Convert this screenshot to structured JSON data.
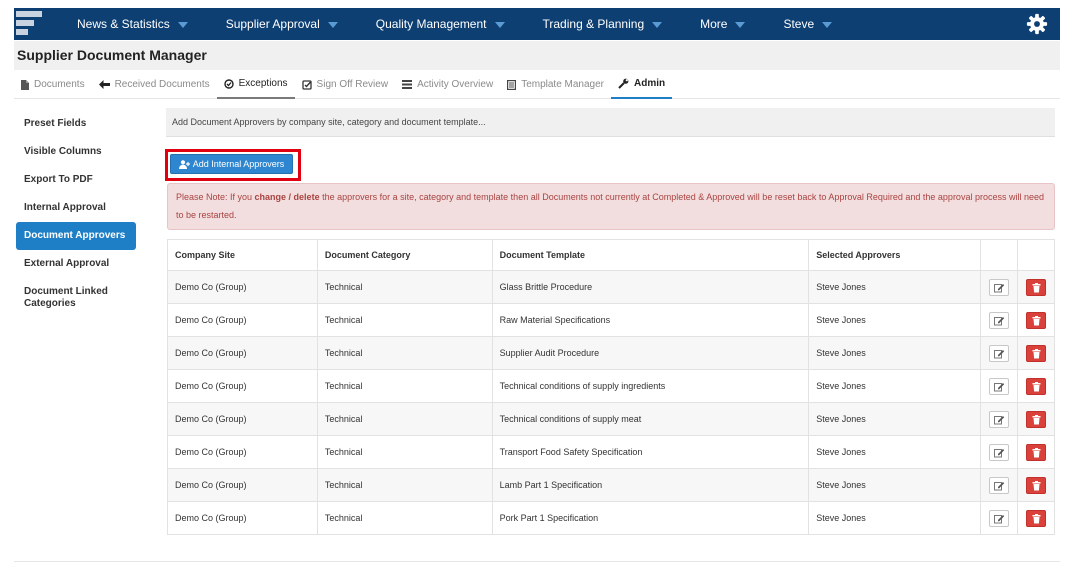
{
  "nav": {
    "items": [
      {
        "label": "News & Statistics"
      },
      {
        "label": "Supplier Approval"
      },
      {
        "label": "Quality Management"
      },
      {
        "label": "Trading & Planning"
      },
      {
        "label": "More"
      },
      {
        "label": "Steve"
      }
    ],
    "icons": {
      "logo": "app-logo",
      "settings": "gear-icon",
      "dropdown": "caret-down-icon"
    }
  },
  "page_title": "Supplier Document Manager",
  "tabs": [
    {
      "label": "Documents",
      "icon": "file-icon"
    },
    {
      "label": "Received Documents",
      "icon": "arrow-left-icon"
    },
    {
      "label": "Exceptions",
      "icon": "check-circle-icon"
    },
    {
      "label": "Sign Off Review",
      "icon": "check-square-icon"
    },
    {
      "label": "Activity Overview",
      "icon": "list-icon"
    },
    {
      "label": "Template Manager",
      "icon": "document-icon"
    },
    {
      "label": "Admin",
      "icon": "wrench-icon"
    }
  ],
  "sidebar": {
    "items": [
      {
        "label": "Preset Fields"
      },
      {
        "label": "Visible Columns"
      },
      {
        "label": "Export To PDF"
      },
      {
        "label": "Internal Approval"
      },
      {
        "label": "Document Approvers"
      },
      {
        "label": "External Approval"
      },
      {
        "label": "Document Linked Categories"
      }
    ],
    "active_index": 4
  },
  "info_text": "Add Document Approvers by company site, category and document template...",
  "add_button": {
    "label": "Add Internal Approvers",
    "icon": "add-user-icon"
  },
  "alert": {
    "prefix": "Please Note: If you ",
    "bold": "change / delete",
    "suffix": " the approvers for a site, category and template then all Documents not currently at Completed & Approved will be reset back to Approval Required and the approval process will need to be restarted."
  },
  "table": {
    "headers": [
      "Company Site",
      "Document Category",
      "Document Template",
      "Selected Approvers"
    ],
    "rows": [
      {
        "site": "Demo Co (Group)",
        "category": "Technical",
        "template": "Glass Brittle Procedure",
        "approvers": "Steve Jones"
      },
      {
        "site": "Demo Co (Group)",
        "category": "Technical",
        "template": "Raw Material Specifications",
        "approvers": "Steve Jones"
      },
      {
        "site": "Demo Co (Group)",
        "category": "Technical",
        "template": "Supplier Audit Procedure",
        "approvers": "Steve Jones"
      },
      {
        "site": "Demo Co (Group)",
        "category": "Technical",
        "template": "Technical conditions of supply ingredients",
        "approvers": "Steve Jones"
      },
      {
        "site": "Demo Co (Group)",
        "category": "Technical",
        "template": "Technical conditions of supply meat",
        "approvers": "Steve Jones"
      },
      {
        "site": "Demo Co (Group)",
        "category": "Technical",
        "template": "Transport Food Safety Specification",
        "approvers": "Steve Jones"
      },
      {
        "site": "Demo Co (Group)",
        "category": "Technical",
        "template": "Lamb Part 1 Specification",
        "approvers": "Steve Jones"
      },
      {
        "site": "Demo Co (Group)",
        "category": "Technical",
        "template": "Pork Part 1 Specification",
        "approvers": "Steve Jones"
      }
    ],
    "row_icons": {
      "edit": "edit-icon",
      "delete": "trash-icon"
    }
  },
  "colors": {
    "nav_bg": "#0e3f73",
    "accent": "#1e7fc6",
    "alert_bg": "#f2dede",
    "alert_text": "#a94442",
    "delete": "#d9413a",
    "highlight": "#e0000f"
  }
}
